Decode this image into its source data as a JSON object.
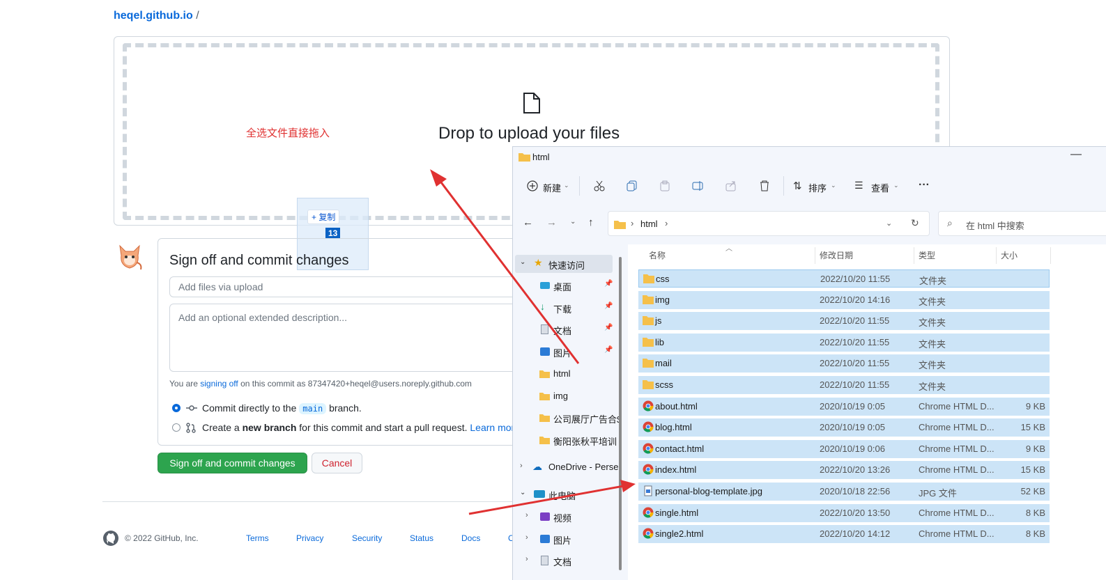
{
  "github": {
    "breadcrumb_repo": "heqel.github.io",
    "breadcrumb_sep": "/",
    "drop_text": "Drop to upload your files",
    "annotation": "全选文件直接拖入",
    "drag_copy": "+ 复制",
    "drag_count": "13",
    "commit_title": "Sign off and commit changes",
    "summary_placeholder": "Add files via upload",
    "description_placeholder": "Add an optional extended description...",
    "sign_prefix": "You are ",
    "sign_link": "signing off",
    "sign_suffix": " on this commit as 87347420+heqel@users.noreply.github.com",
    "opt1_pre": "Commit directly to the",
    "opt1_branch": "main",
    "opt1_post": "branch.",
    "opt2_pre": "Create a ",
    "opt2_bold": "new branch",
    "opt2_post": " for this commit and start a pull request.",
    "opt2_link": "Learn more",
    "submit_button": "Sign off and commit changes",
    "cancel_button": "Cancel",
    "footer_copy": "© 2022 GitHub, Inc.",
    "footer_links": [
      "Terms",
      "Privacy",
      "Security",
      "Status",
      "Docs",
      "C"
    ]
  },
  "explorer": {
    "title": "html",
    "toolbar": {
      "new": "新建",
      "sort": "排序",
      "view": "查看",
      "more": "···"
    },
    "address": [
      "html"
    ],
    "search_placeholder": "在 html 中搜索",
    "sidebar": [
      {
        "label": "快速访问",
        "icon": "star-icon"
      },
      {
        "label": "桌面",
        "icon": "desktop-icon"
      },
      {
        "label": "下载",
        "icon": "download-icon"
      },
      {
        "label": "文档",
        "icon": "document-icon"
      },
      {
        "label": "图片",
        "icon": "picture-icon"
      },
      {
        "label": "html",
        "icon": "folder-icon"
      },
      {
        "label": "img",
        "icon": "folder-icon"
      },
      {
        "label": "公司展厅广告合$",
        "icon": "folder-icon"
      },
      {
        "label": "衡阳张秋平培训",
        "icon": "folder-icon"
      },
      {
        "label": "OneDrive - Perse",
        "icon": "cloud-icon"
      },
      {
        "label": "此电脑",
        "icon": "pc-icon"
      },
      {
        "label": "视频",
        "icon": "video-icon"
      },
      {
        "label": "图片",
        "icon": "picture-icon"
      },
      {
        "label": "文档",
        "icon": "document-icon"
      }
    ],
    "columns": {
      "name": "名称",
      "date": "修改日期",
      "type": "类型",
      "size": "大小"
    },
    "files": [
      {
        "name": "css",
        "date": "2022/10/20 11:55",
        "type": "文件夹",
        "size": "",
        "kind": "folder"
      },
      {
        "name": "img",
        "date": "2022/10/20 14:16",
        "type": "文件夹",
        "size": "",
        "kind": "folder"
      },
      {
        "name": "js",
        "date": "2022/10/20 11:55",
        "type": "文件夹",
        "size": "",
        "kind": "folder"
      },
      {
        "name": "lib",
        "date": "2022/10/20 11:55",
        "type": "文件夹",
        "size": "",
        "kind": "folder"
      },
      {
        "name": "mail",
        "date": "2022/10/20 11:55",
        "type": "文件夹",
        "size": "",
        "kind": "folder"
      },
      {
        "name": "scss",
        "date": "2022/10/20 11:55",
        "type": "文件夹",
        "size": "",
        "kind": "folder"
      },
      {
        "name": "about.html",
        "date": "2020/10/19 0:05",
        "type": "Chrome HTML D...",
        "size": "9 KB",
        "kind": "chrome"
      },
      {
        "name": "blog.html",
        "date": "2020/10/19 0:05",
        "type": "Chrome HTML D...",
        "size": "15 KB",
        "kind": "chrome"
      },
      {
        "name": "contact.html",
        "date": "2020/10/19 0:06",
        "type": "Chrome HTML D...",
        "size": "9 KB",
        "kind": "chrome"
      },
      {
        "name": "index.html",
        "date": "2022/10/20 13:26",
        "type": "Chrome HTML D...",
        "size": "15 KB",
        "kind": "chrome"
      },
      {
        "name": "personal-blog-template.jpg",
        "date": "2020/10/18 22:56",
        "type": "JPG 文件",
        "size": "52 KB",
        "kind": "image"
      },
      {
        "name": "single.html",
        "date": "2022/10/20 13:50",
        "type": "Chrome HTML D...",
        "size": "8 KB",
        "kind": "chrome"
      },
      {
        "name": "single2.html",
        "date": "2022/10/20 14:12",
        "type": "Chrome HTML D...",
        "size": "8 KB",
        "kind": "chrome"
      }
    ]
  },
  "colors": {
    "accent": "#0969da",
    "green": "#2da44e",
    "selection": "#cce4f7",
    "arrow": "#e03131"
  }
}
